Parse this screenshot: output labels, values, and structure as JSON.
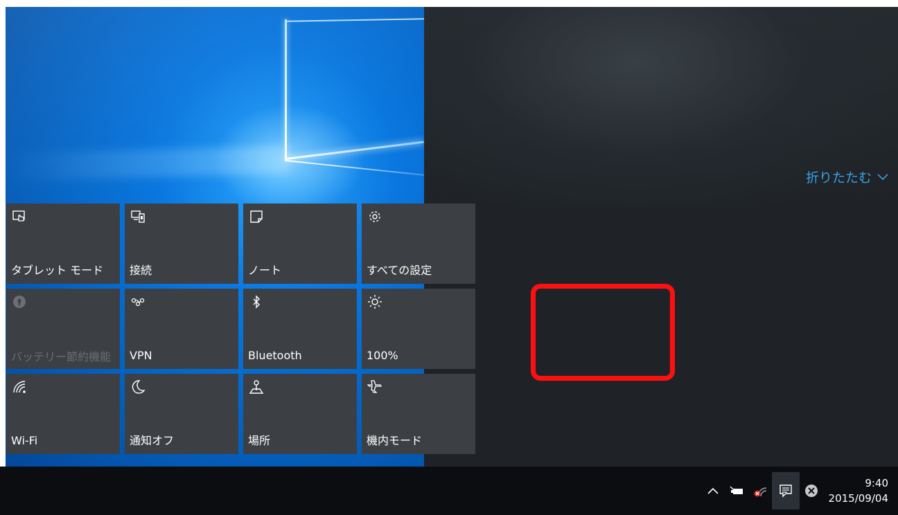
{
  "action_center": {
    "collapse_label": "折りたたむ"
  },
  "tiles": [
    {
      "label": "タブレット モード",
      "icon": "tablet-mode-icon",
      "enabled": true
    },
    {
      "label": "接続",
      "icon": "connect-icon",
      "enabled": true
    },
    {
      "label": "ノート",
      "icon": "note-icon",
      "enabled": true
    },
    {
      "label": "すべての設定",
      "icon": "gear-icon",
      "enabled": true
    },
    {
      "label": "バッテリー節約機能",
      "icon": "battery-saver-icon",
      "enabled": false
    },
    {
      "label": "VPN",
      "icon": "vpn-icon",
      "enabled": true
    },
    {
      "label": "Bluetooth",
      "icon": "bluetooth-icon",
      "enabled": true
    },
    {
      "label": "100%",
      "icon": "brightness-icon",
      "enabled": true
    },
    {
      "label": "Wi-Fi",
      "icon": "wifi-icon",
      "enabled": true
    },
    {
      "label": "通知オフ",
      "icon": "quiet-hours-icon",
      "enabled": true
    },
    {
      "label": "場所",
      "icon": "location-icon",
      "enabled": true
    },
    {
      "label": "機内モード",
      "icon": "airplane-icon",
      "enabled": true
    }
  ],
  "taskbar": {
    "tray_icons": [
      "chevron-up-icon",
      "power-plug-icon",
      "network-error-icon",
      "action-center-icon",
      "close-circle-icon"
    ],
    "time": "9:40",
    "date": "2015/09/04"
  },
  "colors": {
    "accent": "#3aa0e8",
    "tile": "#3c4044",
    "highlight": "#ff1010"
  }
}
